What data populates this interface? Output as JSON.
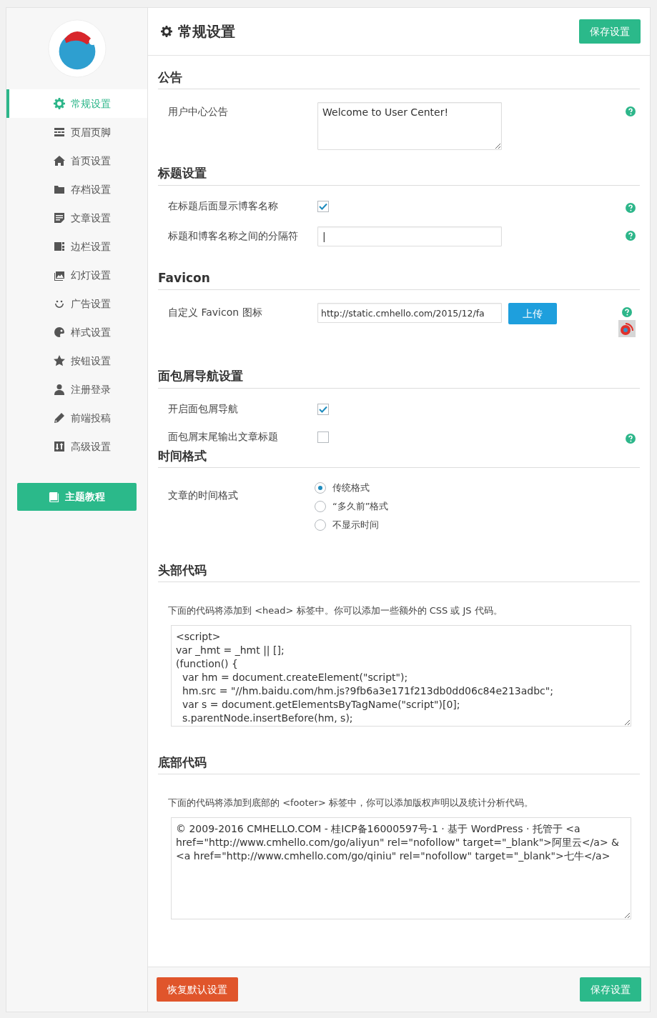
{
  "sidebar": {
    "items": [
      {
        "label": "常规设置",
        "selected": true
      },
      {
        "label": "页眉页脚",
        "selected": false
      },
      {
        "label": "首页设置",
        "selected": false
      },
      {
        "label": "存档设置",
        "selected": false
      },
      {
        "label": "文章设置",
        "selected": false
      },
      {
        "label": "边栏设置",
        "selected": false
      },
      {
        "label": "幻灯设置",
        "selected": false
      },
      {
        "label": "广告设置",
        "selected": false
      },
      {
        "label": "样式设置",
        "selected": false
      },
      {
        "label": "按钮设置",
        "selected": false
      },
      {
        "label": "注册登录",
        "selected": false
      },
      {
        "label": "前端投稿",
        "selected": false
      },
      {
        "label": "高级设置",
        "selected": false
      }
    ],
    "tutorial_button": "主题教程"
  },
  "header": {
    "title": "常规设置",
    "save_button": "保存设置"
  },
  "sections": [
    {
      "title": "公告",
      "rows": [
        {
          "kind": "textarea",
          "label": "用户中心公告",
          "value": "Welcome to User Center!",
          "help": true
        }
      ]
    },
    {
      "title": "标题设置",
      "rows": [
        {
          "kind": "checkbox",
          "label": "在标题后面显示博客名称",
          "checked": true,
          "help": true
        },
        {
          "kind": "text",
          "label": "标题和博客名称之间的分隔符",
          "value": "|",
          "help": true
        }
      ]
    },
    {
      "title": "Favicon",
      "rows": [
        {
          "kind": "upload",
          "label": "自定义 Favicon 图标",
          "value": "http://static.cmhello.com/2015/12/fa",
          "button": "上传",
          "help": true,
          "preview": true
        }
      ]
    },
    {
      "title": "面包屑导航设置",
      "rows": [
        {
          "kind": "checkbox",
          "label": "开启面包屑导航",
          "checked": true,
          "help": false
        },
        {
          "kind": "checkbox",
          "label": "面包屑末尾输出文章标题",
          "checked": false,
          "help": true
        }
      ]
    },
    {
      "title": "时间格式",
      "rows": [
        {
          "kind": "radio",
          "label": "文章的时间格式",
          "options": [
            {
              "label": "传统格式",
              "selected": true
            },
            {
              "label": "“多久前”格式",
              "selected": false
            },
            {
              "label": "不显示时间",
              "selected": false
            }
          ]
        }
      ]
    },
    {
      "title": "头部代码",
      "rows": [
        {
          "kind": "code",
          "description": "下面的代码将添加到 <head> 标签中。你可以添加一些额外的 CSS 或 JS 代码。",
          "value": "<script>\nvar _hmt = _hmt || [];\n(function() {\n  var hm = document.createElement(\"script\");\n  hm.src = \"//hm.baidu.com/hm.js?9fb6a3e171f213db0dd06c84e213adbc\";\n  var s = document.getElementsByTagName(\"script\")[0];\n  s.parentNode.insertBefore(hm, s);",
          "scroll": true
        }
      ]
    },
    {
      "title": "底部代码",
      "rows": [
        {
          "kind": "code",
          "description": "下面的代码将添加到底部的 <footer> 标签中，你可以添加版权声明以及统计分析代码。",
          "value": "© 2009-2016 CMHELLO.COM - 桂ICP备16000597号-1 · 基于 WordPress · 托管于 <a href=\"http://www.cmhello.com/go/aliyun\" rel=\"nofollow\" target=\"_blank\">阿里云</a> & <a href=\"http://www.cmhello.com/go/qiniu\" rel=\"nofollow\" target=\"_blank\">七牛</a>",
          "scroll": false
        }
      ]
    }
  ],
  "footer": {
    "reset_button": "恢复默认设置",
    "save_button": "保存设置"
  }
}
